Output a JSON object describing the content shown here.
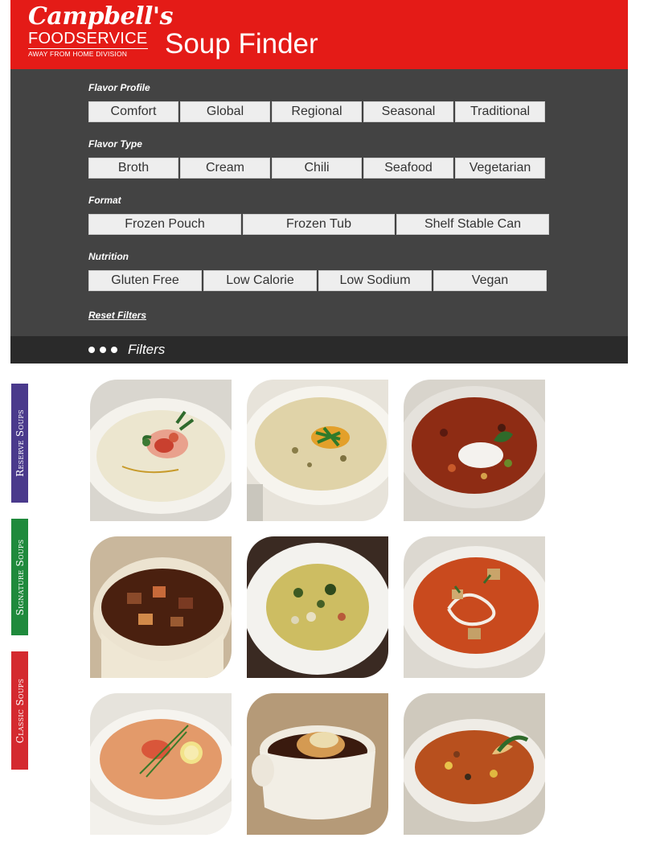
{
  "header": {
    "logo": {
      "line1": "Campbell's",
      "line2": "FOODSERVICE",
      "line3": "AWAY FROM HOME DIVISION"
    },
    "title": "Soup Finder"
  },
  "filters": {
    "groups": [
      {
        "label": "Flavor Profile",
        "options": [
          "Comfort",
          "Global",
          "Regional",
          "Seasonal",
          "Traditional"
        ]
      },
      {
        "label": "Flavor Type",
        "options": [
          "Broth",
          "Cream",
          "Chili",
          "Seafood",
          "Vegetarian"
        ]
      },
      {
        "label": "Format",
        "options": [
          "Frozen Pouch",
          "Frozen Tub",
          "Shelf Stable Can"
        ]
      },
      {
        "label": "Nutrition",
        "options": [
          "Gluten Free",
          "Low Calorie",
          "Low Sodium",
          "Vegan"
        ]
      }
    ],
    "reset_label": "Reset Filters",
    "toggle_label": "Filters"
  },
  "side_tabs": [
    {
      "label": "Reserve Soups",
      "color": "#4a3a8c"
    },
    {
      "label": "Signature Soups",
      "color": "#1f8a3c"
    },
    {
      "label": "Classic Soups",
      "color": "#d42a2f"
    }
  ],
  "colors": {
    "brand_red": "#e41b17",
    "panel": "#434343",
    "bar": "#2a2a2a"
  }
}
